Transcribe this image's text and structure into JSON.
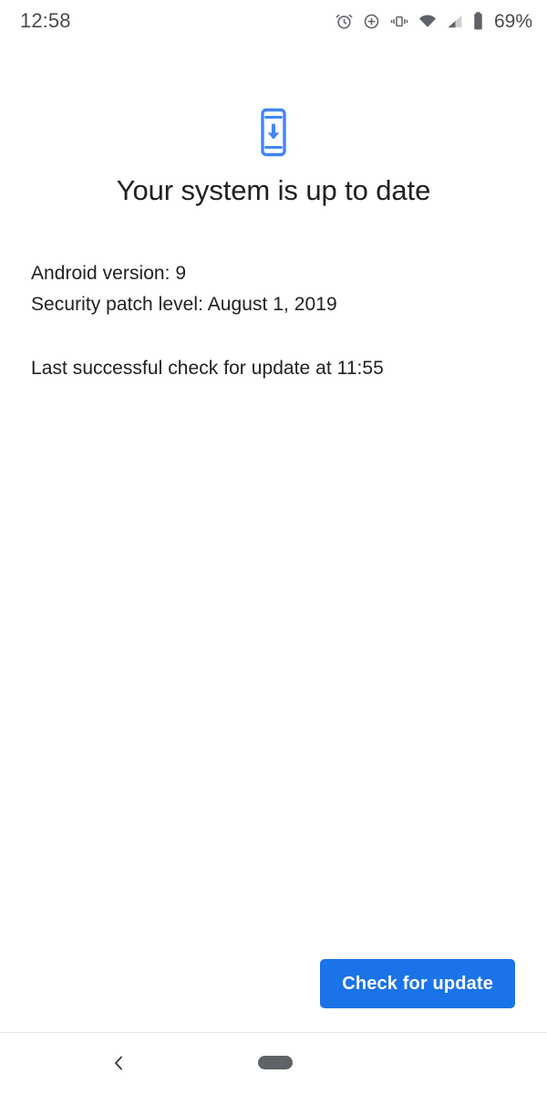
{
  "status_bar": {
    "time": "12:58",
    "battery_percent": "69%",
    "icons": [
      {
        "name": "alarm-icon"
      },
      {
        "name": "do-not-disturb-icon"
      },
      {
        "name": "vibrate-icon"
      },
      {
        "name": "wifi-icon"
      },
      {
        "name": "cellular-signal-icon"
      },
      {
        "name": "battery-icon"
      }
    ]
  },
  "header": {
    "icon_name": "system-update-icon",
    "icon_color": "#4285f4",
    "title": "Your system is up to date"
  },
  "details": {
    "android_version": "Android version: 9",
    "security_patch": "Security patch level: August 1, 2019",
    "last_check": "Last successful check for update at 11:55"
  },
  "actions": {
    "check_update_label": "Check for update",
    "accent_color": "#1a73e8"
  },
  "nav_bar": {
    "back_icon": "chevron-left-icon",
    "home_handle": "home-pill-handle"
  }
}
